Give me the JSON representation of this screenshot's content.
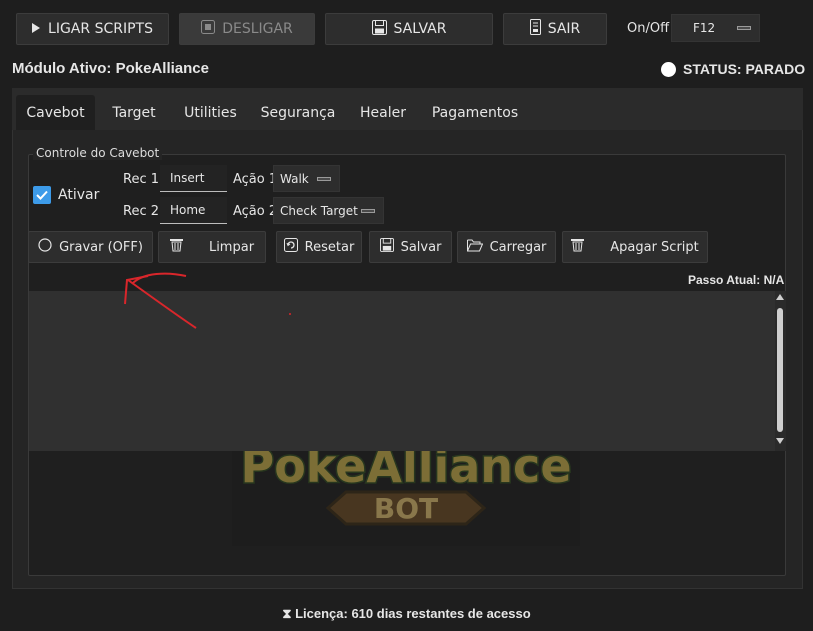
{
  "toolbar": {
    "start_label": "LIGAR SCRIPTS",
    "stop_label": "DESLIGAR",
    "save_label": "SALVAR",
    "exit_label": "SAIR",
    "onoff_label": "On/Off",
    "hotkey_value": "F12"
  },
  "header": {
    "module_label": "Módulo Ativo: PokeAlliance",
    "status_label": "STATUS: PARADO"
  },
  "tabs": [
    {
      "label": "Cavebot",
      "active": true
    },
    {
      "label": "Target"
    },
    {
      "label": "Utilities"
    },
    {
      "label": "Segurança"
    },
    {
      "label": "Healer"
    },
    {
      "label": "Pagamentos"
    }
  ],
  "cavebot": {
    "group_title": "Controle do Cavebot",
    "enable_label": "Ativar",
    "enabled": true,
    "rec1_label": "Rec 1:",
    "rec1_value": "Insert",
    "action1_label": "Ação 1:",
    "action1_value": "Walk",
    "rec2_label": "Rec 2:",
    "rec2_value": "Home",
    "action2_label": "Ação 2:",
    "action2_value": "Check Target",
    "buttons": {
      "record": "Gravar (OFF)",
      "clear": "Limpar",
      "reset": "Resetar",
      "save": "Salvar",
      "load": "Carregar",
      "delete": "Apagar Script"
    },
    "step_label": "Passo Atual: N/A"
  },
  "logo": {
    "title": "PokeAlliance",
    "subtitle": "BOT"
  },
  "footer": {
    "license_label": "Licença: 610 dias restantes de acesso"
  },
  "colors": {
    "accent": "#3d9be9",
    "annotation": "#d9262b"
  }
}
